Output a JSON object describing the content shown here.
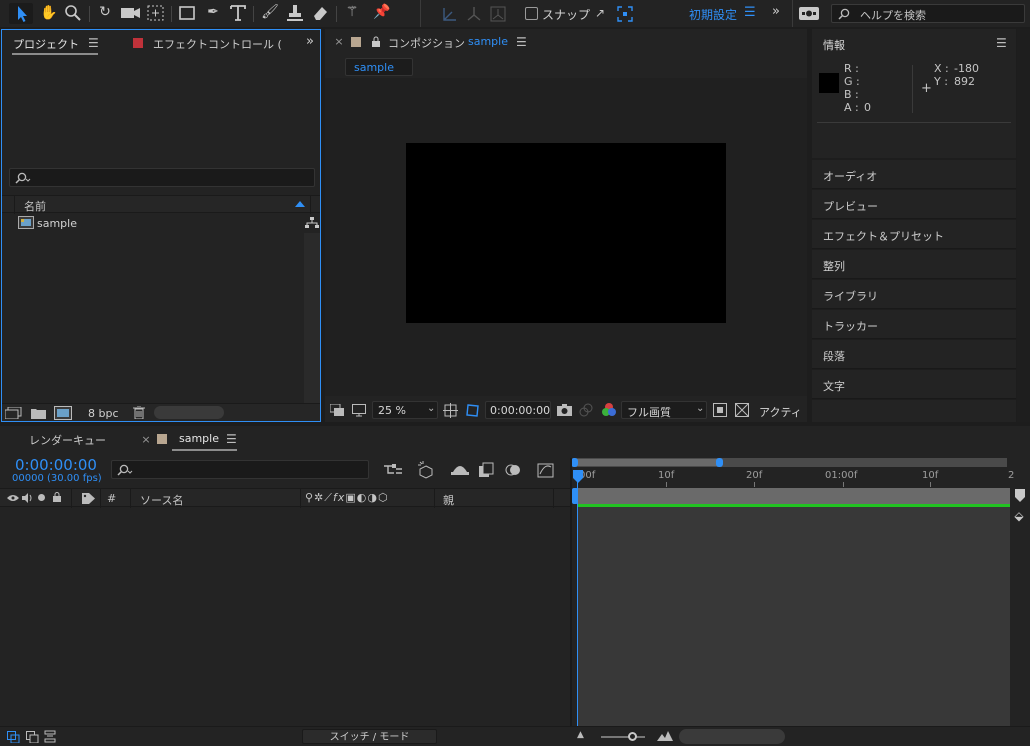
{
  "toolbar": {
    "snap_label": "スナップ",
    "workspace_label": "初期設定",
    "search_placeholder": "ヘルプを検索",
    "icons": [
      "selection-icon",
      "hand-icon",
      "zoom-icon",
      "rotate-icon",
      "camera-icon",
      "pan-behind-icon",
      "rectangle-icon",
      "pen-icon",
      "type-icon",
      "brush-icon",
      "clone-stamp-icon",
      "eraser-icon",
      "roto-brush-icon",
      "puppet-pin-icon"
    ]
  },
  "project_panel": {
    "tab_project": "プロジェクト",
    "tab_effect_controls": "エフェクトコントロール (",
    "column_name": "名前",
    "items": [
      {
        "name": "sample"
      }
    ],
    "bpc": "8 bpc"
  },
  "composition_panel": {
    "tab_prefix": "コンポジション",
    "tab_name": "sample",
    "breadcrumb": "sample",
    "zoom": "25 %",
    "timecode": "0:00:00:00",
    "resolution": "フル画質",
    "camera": "アクティ"
  },
  "info_panel": {
    "title": "情報",
    "r_label": "R :",
    "g_label": "G :",
    "b_label": "B :",
    "a_label": "A :",
    "a_value": "0",
    "x_label": "X :",
    "x_value": "-180",
    "y_label": "Y :",
    "y_value": "892"
  },
  "side_panels": [
    "オーディオ",
    "プレビュー",
    "エフェクト＆プリセット",
    "整列",
    "ライブラリ",
    "トラッカー",
    "段落",
    "文字"
  ],
  "timeline": {
    "tab_render_queue": "レンダーキュー",
    "tab_comp": "sample",
    "timecode": "0:00:00:00",
    "frame_info": "00000 (30.00 fps)",
    "col_hash": "#",
    "col_source_name": "ソース名",
    "col_parent": "親",
    "ruler_labels": [
      "00f",
      "10f",
      "20f",
      "01:00f",
      "10f",
      "2"
    ],
    "switch_mode_label": "スイッチ / モード"
  },
  "colors": {
    "accent": "#2f8ff6",
    "effect_tab_swatch": "#c0323a",
    "comp_swatch": "#b8a690",
    "work_area_green": "#22c322"
  }
}
